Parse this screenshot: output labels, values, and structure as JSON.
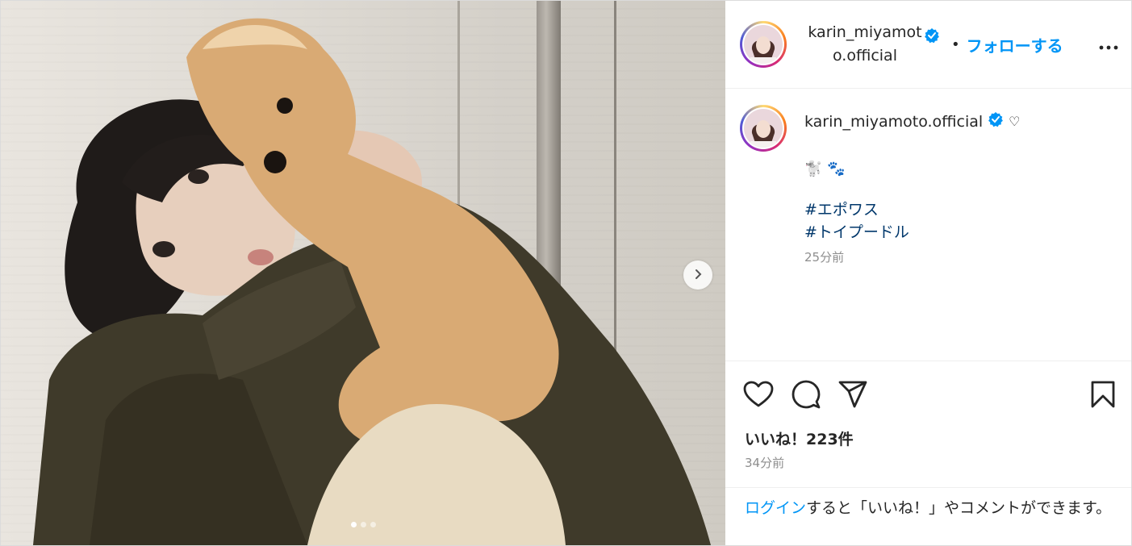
{
  "post": {
    "media": {
      "slide_count": 3,
      "active_slide": 1
    },
    "header": {
      "username_line1": "karin_miyamot",
      "username_line2": "o.official",
      "separator": "•",
      "follow_label": "フォローする",
      "more_label": "•••"
    },
    "caption": {
      "username": "karin_miyamoto.official",
      "heart": "♡",
      "emoji_line": "🐩 🐾",
      "hashtags": [
        "#エポワス",
        "#トイプードル"
      ],
      "time": "25分前"
    },
    "likes_text": "いいね！223件",
    "post_time": "34分前",
    "login_prompt": {
      "link": "ログイン",
      "text": "すると「いいね！」やコメントができます。"
    },
    "colors": {
      "accent": "#0095f6",
      "hashtag": "#00376b",
      "muted": "#8e8e8e",
      "verified": "#0095f6"
    },
    "icons": [
      "heart-icon",
      "comment-icon",
      "share-icon",
      "bookmark-icon",
      "chevron-right-icon",
      "verified-icon",
      "more-icon"
    ]
  }
}
